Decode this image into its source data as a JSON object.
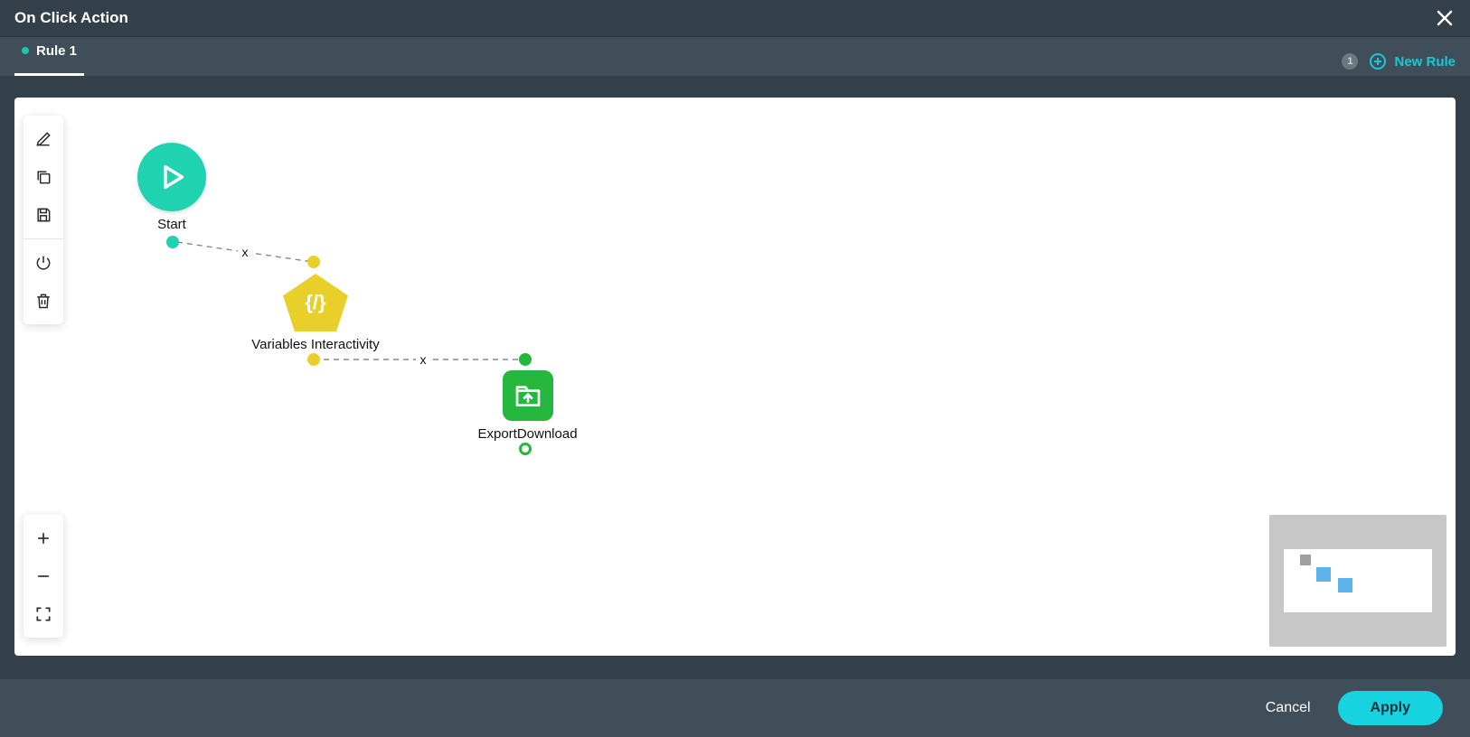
{
  "header": {
    "title": "On Click Action"
  },
  "tabs": {
    "active": {
      "label": "Rule 1"
    },
    "count": "1",
    "new_rule_label": "New Rule"
  },
  "toolbar": {
    "edit": "edit",
    "copy": "copy",
    "save": "save",
    "power": "power",
    "delete": "delete",
    "zoom_in": "zoom-in",
    "zoom_out": "zoom-out",
    "fullscreen": "fullscreen"
  },
  "nodes": {
    "start": {
      "label": "Start"
    },
    "variables": {
      "label": "Variables Interactivity",
      "glyph": "{/}"
    },
    "export": {
      "label": "ExportDownload"
    }
  },
  "edges": {
    "x_label": "x"
  },
  "footer": {
    "cancel": "Cancel",
    "apply": "Apply"
  }
}
